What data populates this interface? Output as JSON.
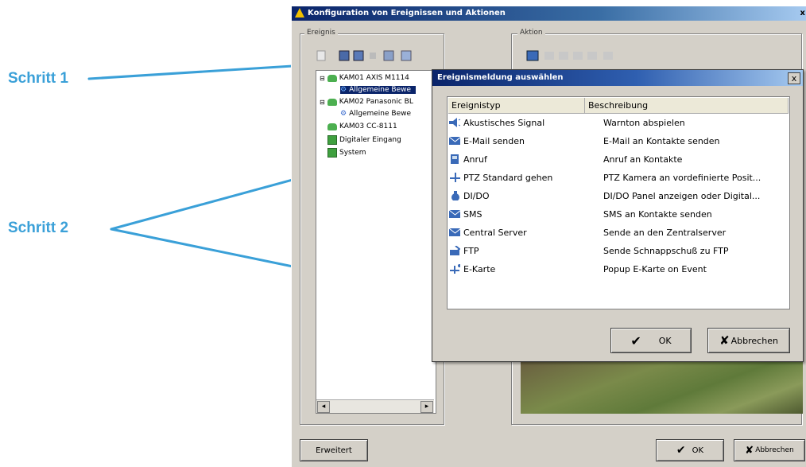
{
  "callouts": {
    "step1": "Schritt 1",
    "step2": "Schritt 2"
  },
  "main_window": {
    "title": "Konfiguration von Ereignissen und Aktionen",
    "close": "x",
    "event_group_label": "Ereignis",
    "action_group_label": "Aktion",
    "tree": [
      {
        "label": "KAM01 AXIS M1114",
        "level": 0
      },
      {
        "label": "Allgemeine Bewe",
        "level": 1,
        "selected": true
      },
      {
        "label": "KAM02 Panasonic BL",
        "level": 0
      },
      {
        "label": "Allgemeine Bewe",
        "level": 1
      },
      {
        "label": "KAM03 CC-8111",
        "level": 0
      },
      {
        "label": "Digitaler Eingang",
        "level": 0
      },
      {
        "label": "System",
        "level": 0
      }
    ],
    "scroll_left": "◂",
    "scroll_right": "▸",
    "advanced_button": "Erweitert",
    "ok_button": "OK",
    "cancel_button": "Abbrechen"
  },
  "dialog": {
    "title": "Ereignismeldung auswählen",
    "close": "x",
    "col_type": "Ereignistyp",
    "col_desc": "Beschreibung",
    "rows": [
      {
        "type": "Akustisches Signal",
        "desc": "Warnton abspielen",
        "icon": "speaker-icon"
      },
      {
        "type": "E-Mail senden",
        "desc": "E-Mail an Kontakte senden",
        "icon": "mail-icon"
      },
      {
        "type": "Anruf",
        "desc": "Anruf an Kontakte",
        "icon": "phone-icon"
      },
      {
        "type": "PTZ Standard gehen",
        "desc": "PTZ Kamera an vordefinierte Posit...",
        "icon": "ptz-arrows-icon"
      },
      {
        "type": "DI/DO",
        "desc": "DI/DO Panel anzeigen oder Digital...",
        "icon": "dido-icon"
      },
      {
        "type": "SMS",
        "desc": "SMS an Kontakte senden",
        "icon": "sms-icon"
      },
      {
        "type": "Central Server",
        "desc": "Sende an den Zentralserver",
        "icon": "server-mail-icon"
      },
      {
        "type": "FTP",
        "desc": "Sende Schnappschuß zu FTP",
        "icon": "ftp-icon"
      },
      {
        "type": "E-Karte",
        "desc": "Popup E-Karte on Event",
        "icon": "emap-icon"
      }
    ],
    "ok_button": "OK",
    "cancel_button": "Abbrechen"
  },
  "colors": {
    "callout": "#3aa0d8",
    "titlebar": "#0a246a",
    "selection": "#0a246a",
    "face": "#d4d0c8"
  }
}
